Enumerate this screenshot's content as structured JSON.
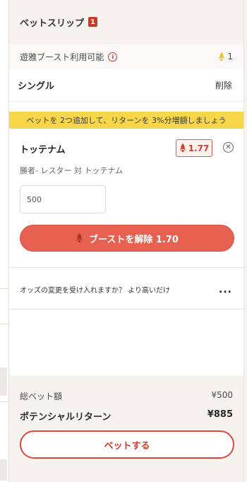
{
  "header": {
    "title": "ベットスリップ",
    "count": "1"
  },
  "boost": {
    "label": "遊雅ブースト利用可能",
    "info_icon": "i",
    "available_count": "1"
  },
  "single": {
    "label": "シングル",
    "delete": "削除"
  },
  "promo": {
    "text": "ベットを 2つ追加して、リターンを 3%分増額しましょう"
  },
  "selection": {
    "name": "トッテナム",
    "odds": "1.77",
    "market": "勝者- レスター 対 トッテナム",
    "stake_value": "500"
  },
  "boost_button": {
    "label": "ブーストを解除 1.70"
  },
  "odds_change": {
    "text": "オッズの変更を受け入れますか？ より高いだけ",
    "more": "..."
  },
  "footer": {
    "total_label": "総ベット額",
    "total_value": "¥500",
    "return_label": "ポテンシャルリターン",
    "return_value": "¥885",
    "bet_button": "ベットする"
  },
  "colors": {
    "accent_red": "#e8604f",
    "badge_red": "#c93a2b",
    "promo_yellow": "#f7d64a",
    "boost_icon_yellow": "#f2c12e"
  },
  "icons": {
    "boost": "rocket-icon",
    "info": "info-icon",
    "close": "close-circle-icon",
    "more": "more-icon"
  }
}
